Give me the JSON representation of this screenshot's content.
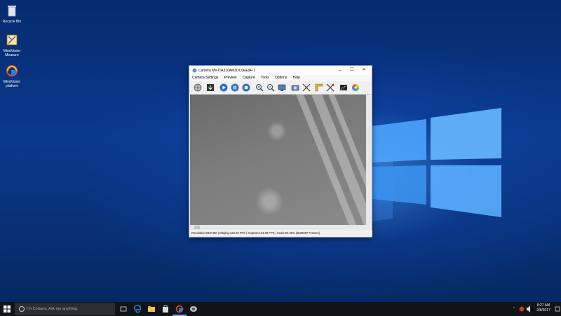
{
  "desktop_icons": [
    {
      "label": "Recycle Bin",
      "icon": "recycle-bin-icon"
    },
    {
      "label": "MindVision Measure",
      "icon": "measure-app-icon"
    },
    {
      "label": "MindVision platform",
      "icon": "platform-app-icon"
    }
  ],
  "window": {
    "title": "Camera MV-ITA310AM3DC0EE9F-1",
    "controls": {
      "minimize": "–",
      "maximize": "☐",
      "close": "✕"
    },
    "menu": [
      "Camera Settings",
      "Preview",
      "Capture",
      "Tools",
      "Options",
      "Help"
    ],
    "toolbar_icons": [
      "globe-icon",
      "import-icon",
      "play-icon",
      "pause-icon",
      "stop-icon",
      "zoom-in-icon",
      "zoom-out-icon",
      "monitor-icon",
      "snapshot-icon",
      "crosshair-icon",
      "ruler-icon",
      "tools-icon",
      "histogram-icon",
      "color-wheel-icon"
    ],
    "status": "Resolution:640*480 | Display:124.00 FPS | Capture:124.00 FPS | Scale:94.66% |8628057 Frames|"
  },
  "taskbar": {
    "search_placeholder": "I'm Cortana. Ask me anything.",
    "pinned_icons": [
      "task-view-icon",
      "edge-icon",
      "file-explorer-icon",
      "store-icon",
      "mindvision-app-icon",
      "camera-app-icon"
    ],
    "time": "8:27 AM",
    "date": "2/8/2017"
  },
  "colors": {
    "accent": "#1e6fd9",
    "taskbar": "#101418"
  }
}
